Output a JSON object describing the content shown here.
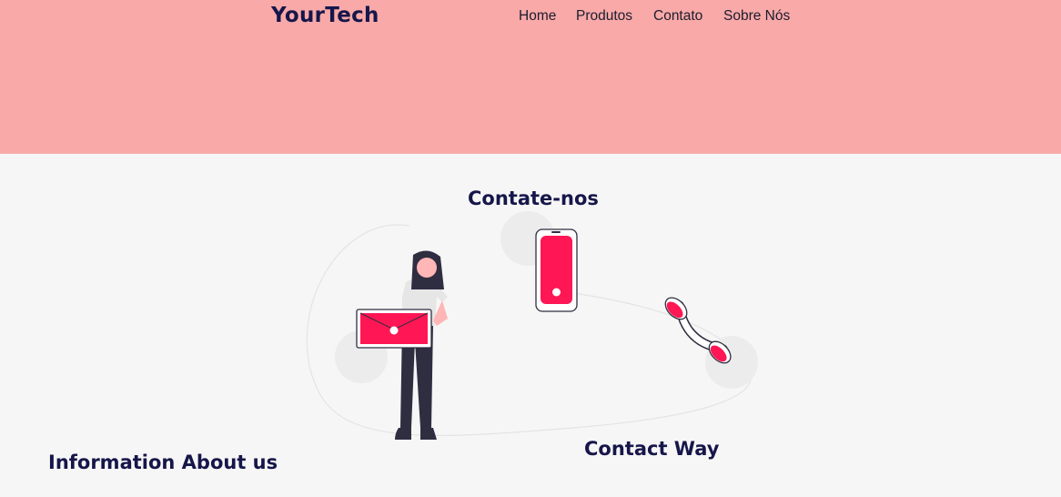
{
  "header": {
    "logo": "YourTech",
    "nav": [
      "Home",
      "Produtos",
      "Contato",
      "Sobre Nós"
    ]
  },
  "main": {
    "title": "Contate-nos",
    "illustration": "woman-with-envelope-phone-illustration",
    "info_title": "Information About us",
    "contact_way": "Contact Way"
  },
  "colors": {
    "header_bg": "#f8a9a8",
    "accent": "#ff1654",
    "dark": "#16164a",
    "page_bg": "#f6f6f6"
  }
}
